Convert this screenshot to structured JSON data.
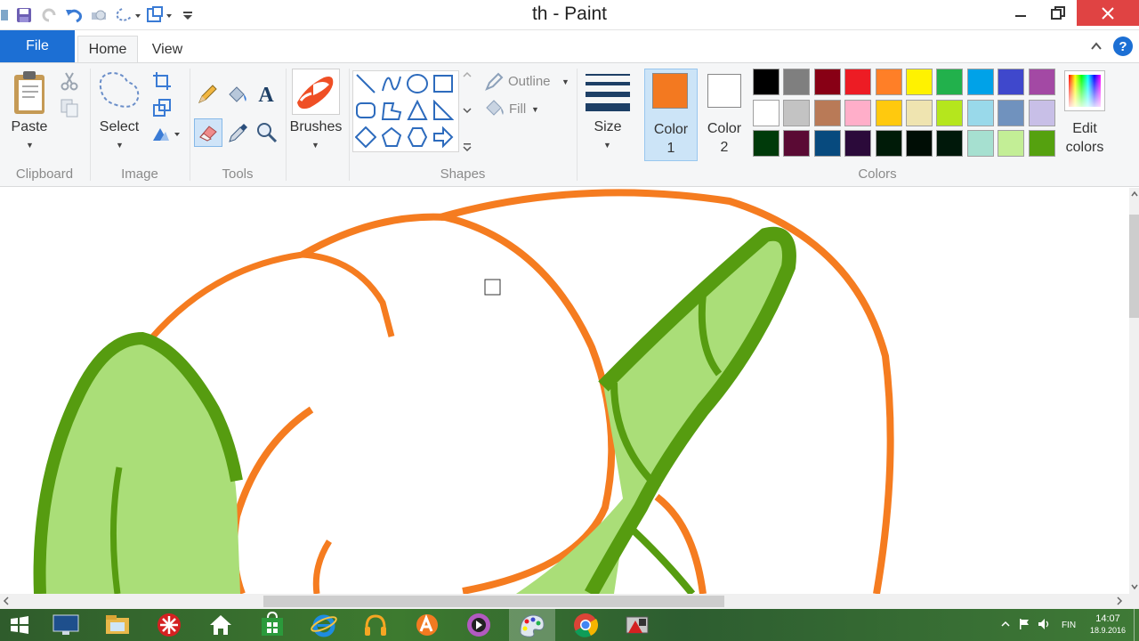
{
  "window": {
    "title": "th - Paint"
  },
  "tabs": {
    "file": "File",
    "home": "Home",
    "view": "View"
  },
  "ribbon": {
    "clipboard": {
      "paste_label": "Paste",
      "group": "Clipboard"
    },
    "image": {
      "select_label": "Select",
      "group": "Image"
    },
    "tools": {
      "group": "Tools"
    },
    "brushes": {
      "label": "Brushes"
    },
    "shapes": {
      "outline_label": "Outline",
      "fill_label": "Fill",
      "group": "Shapes"
    },
    "size": {
      "label": "Size"
    },
    "color1": {
      "label_line1": "Color",
      "label_line2": "1",
      "value": "#f37920"
    },
    "color2": {
      "label_line1": "Color",
      "label_line2": "2",
      "value": "#ffffff"
    },
    "colors": {
      "group": "Colors",
      "edit_line1": "Edit",
      "edit_line2": "colors"
    }
  },
  "palette": [
    "#000000",
    "#7f7f7f",
    "#880015",
    "#ed1c24",
    "#ff7f27",
    "#fff200",
    "#22b14c",
    "#00a2e8",
    "#3f48cc",
    "#a349a4",
    "#ffffff",
    "#c3c3c3",
    "#b97a57",
    "#ffaec9",
    "#ffc90e",
    "#efe4b0",
    "#b5e61d",
    "#99d9ea",
    "#7092be",
    "#c8bfe7",
    "#003a0a",
    "#5a0a34",
    "#074a7e",
    "#2b0a3a",
    "#001b08",
    "#000d05",
    "#00180a",
    "#a6e0d0",
    "#c3ee96",
    "#55a10f"
  ],
  "canvas_colors": {
    "orange": "#f57c20",
    "dark_green": "#569c10",
    "light_green": "#aade78"
  },
  "taskbar": {
    "items": [
      "start",
      "desktop-app",
      "file-explorer",
      "app-red",
      "home",
      "store",
      "internet-explorer",
      "headphones-app",
      "avast",
      "app-dark",
      "paint",
      "chrome",
      "app-misc"
    ],
    "lang": "FIN",
    "time": "14:07",
    "date": "18.9.2016"
  }
}
